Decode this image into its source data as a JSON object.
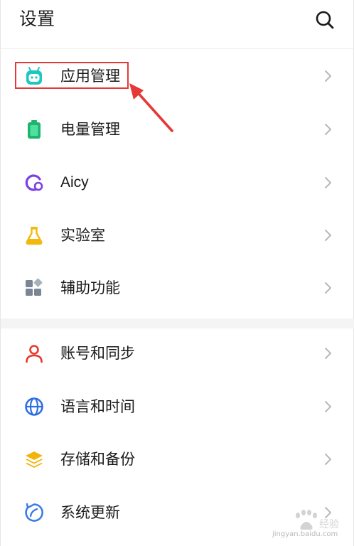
{
  "header": {
    "title": "设置",
    "search_icon": "search-icon"
  },
  "groups": [
    {
      "items": [
        {
          "label": "应用管理",
          "icon": "android-robot-icon",
          "color": "#1fc7c2"
        },
        {
          "label": "电量管理",
          "icon": "battery-icon",
          "color": "#1db46d"
        },
        {
          "label": "Aicy",
          "icon": "aicy-icon",
          "color": "#7b3fe4"
        },
        {
          "label": "实验室",
          "icon": "flask-icon",
          "color": "#f2b90c"
        },
        {
          "label": "辅助功能",
          "icon": "grid-icon",
          "color": "#7a8694"
        }
      ]
    },
    {
      "items": [
        {
          "label": "账号和同步",
          "icon": "user-icon",
          "color": "#e5392d"
        },
        {
          "label": "语言和时间",
          "icon": "globe-icon",
          "color": "#2f6fe0"
        },
        {
          "label": "存储和备份",
          "icon": "layers-icon",
          "color": "#f2b40c"
        },
        {
          "label": "系统更新",
          "icon": "update-icon",
          "color": "#3c7be8"
        }
      ]
    }
  ],
  "annotation": {
    "highlight_color": "#e53935"
  },
  "watermark": {
    "text": "jingyan.baidu.com"
  }
}
